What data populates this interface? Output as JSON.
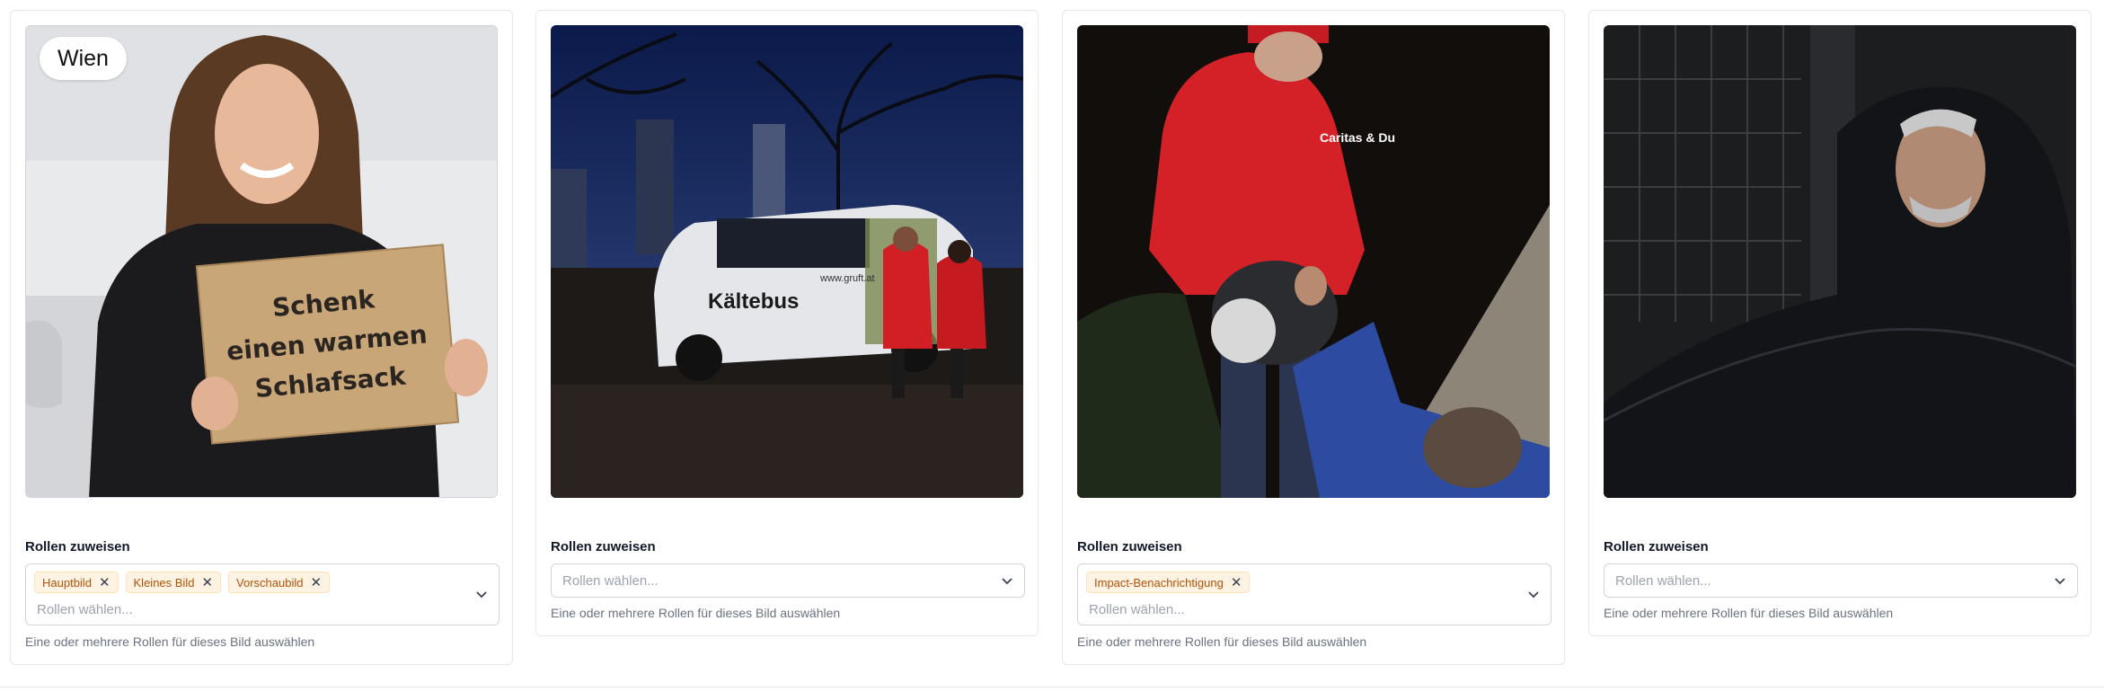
{
  "cards": [
    {
      "badge": "Wien",
      "sign_lines": [
        "Schenk",
        "einen warmen",
        "Schlafsack"
      ],
      "roles_label": "Rollen zuweisen",
      "chips": [
        "Hauptbild",
        "Kleines Bild",
        "Vorschaubild"
      ],
      "placeholder": "Rollen wählen...",
      "help": "Eine oder mehrere Rollen für dieses Bild auswählen"
    },
    {
      "van_text": "Kältebus",
      "van_url": "www.gruft.at",
      "roles_label": "Rollen zuweisen",
      "placeholder": "Rollen wählen...",
      "help": "Eine oder mehrere Rollen für dieses Bild auswählen"
    },
    {
      "jacket_text": "Caritas & Du",
      "roles_label": "Rollen zuweisen",
      "chips": [
        "Impact-Benachrichtigung"
      ],
      "placeholder": "Rollen wählen...",
      "help": "Eine oder mehrere Rollen für dieses Bild auswählen"
    },
    {
      "roles_label": "Rollen zuweisen",
      "placeholder": "Rollen wählen...",
      "help": "Eine oder mehrere Rollen für dieses Bild auswählen"
    }
  ],
  "icons": {
    "chip_remove": "close-icon",
    "dropdown": "chevron-down-icon"
  },
  "colors": {
    "chip_bg": "#fef3e2",
    "chip_text": "#b45309",
    "border": "#e5e7eb"
  }
}
